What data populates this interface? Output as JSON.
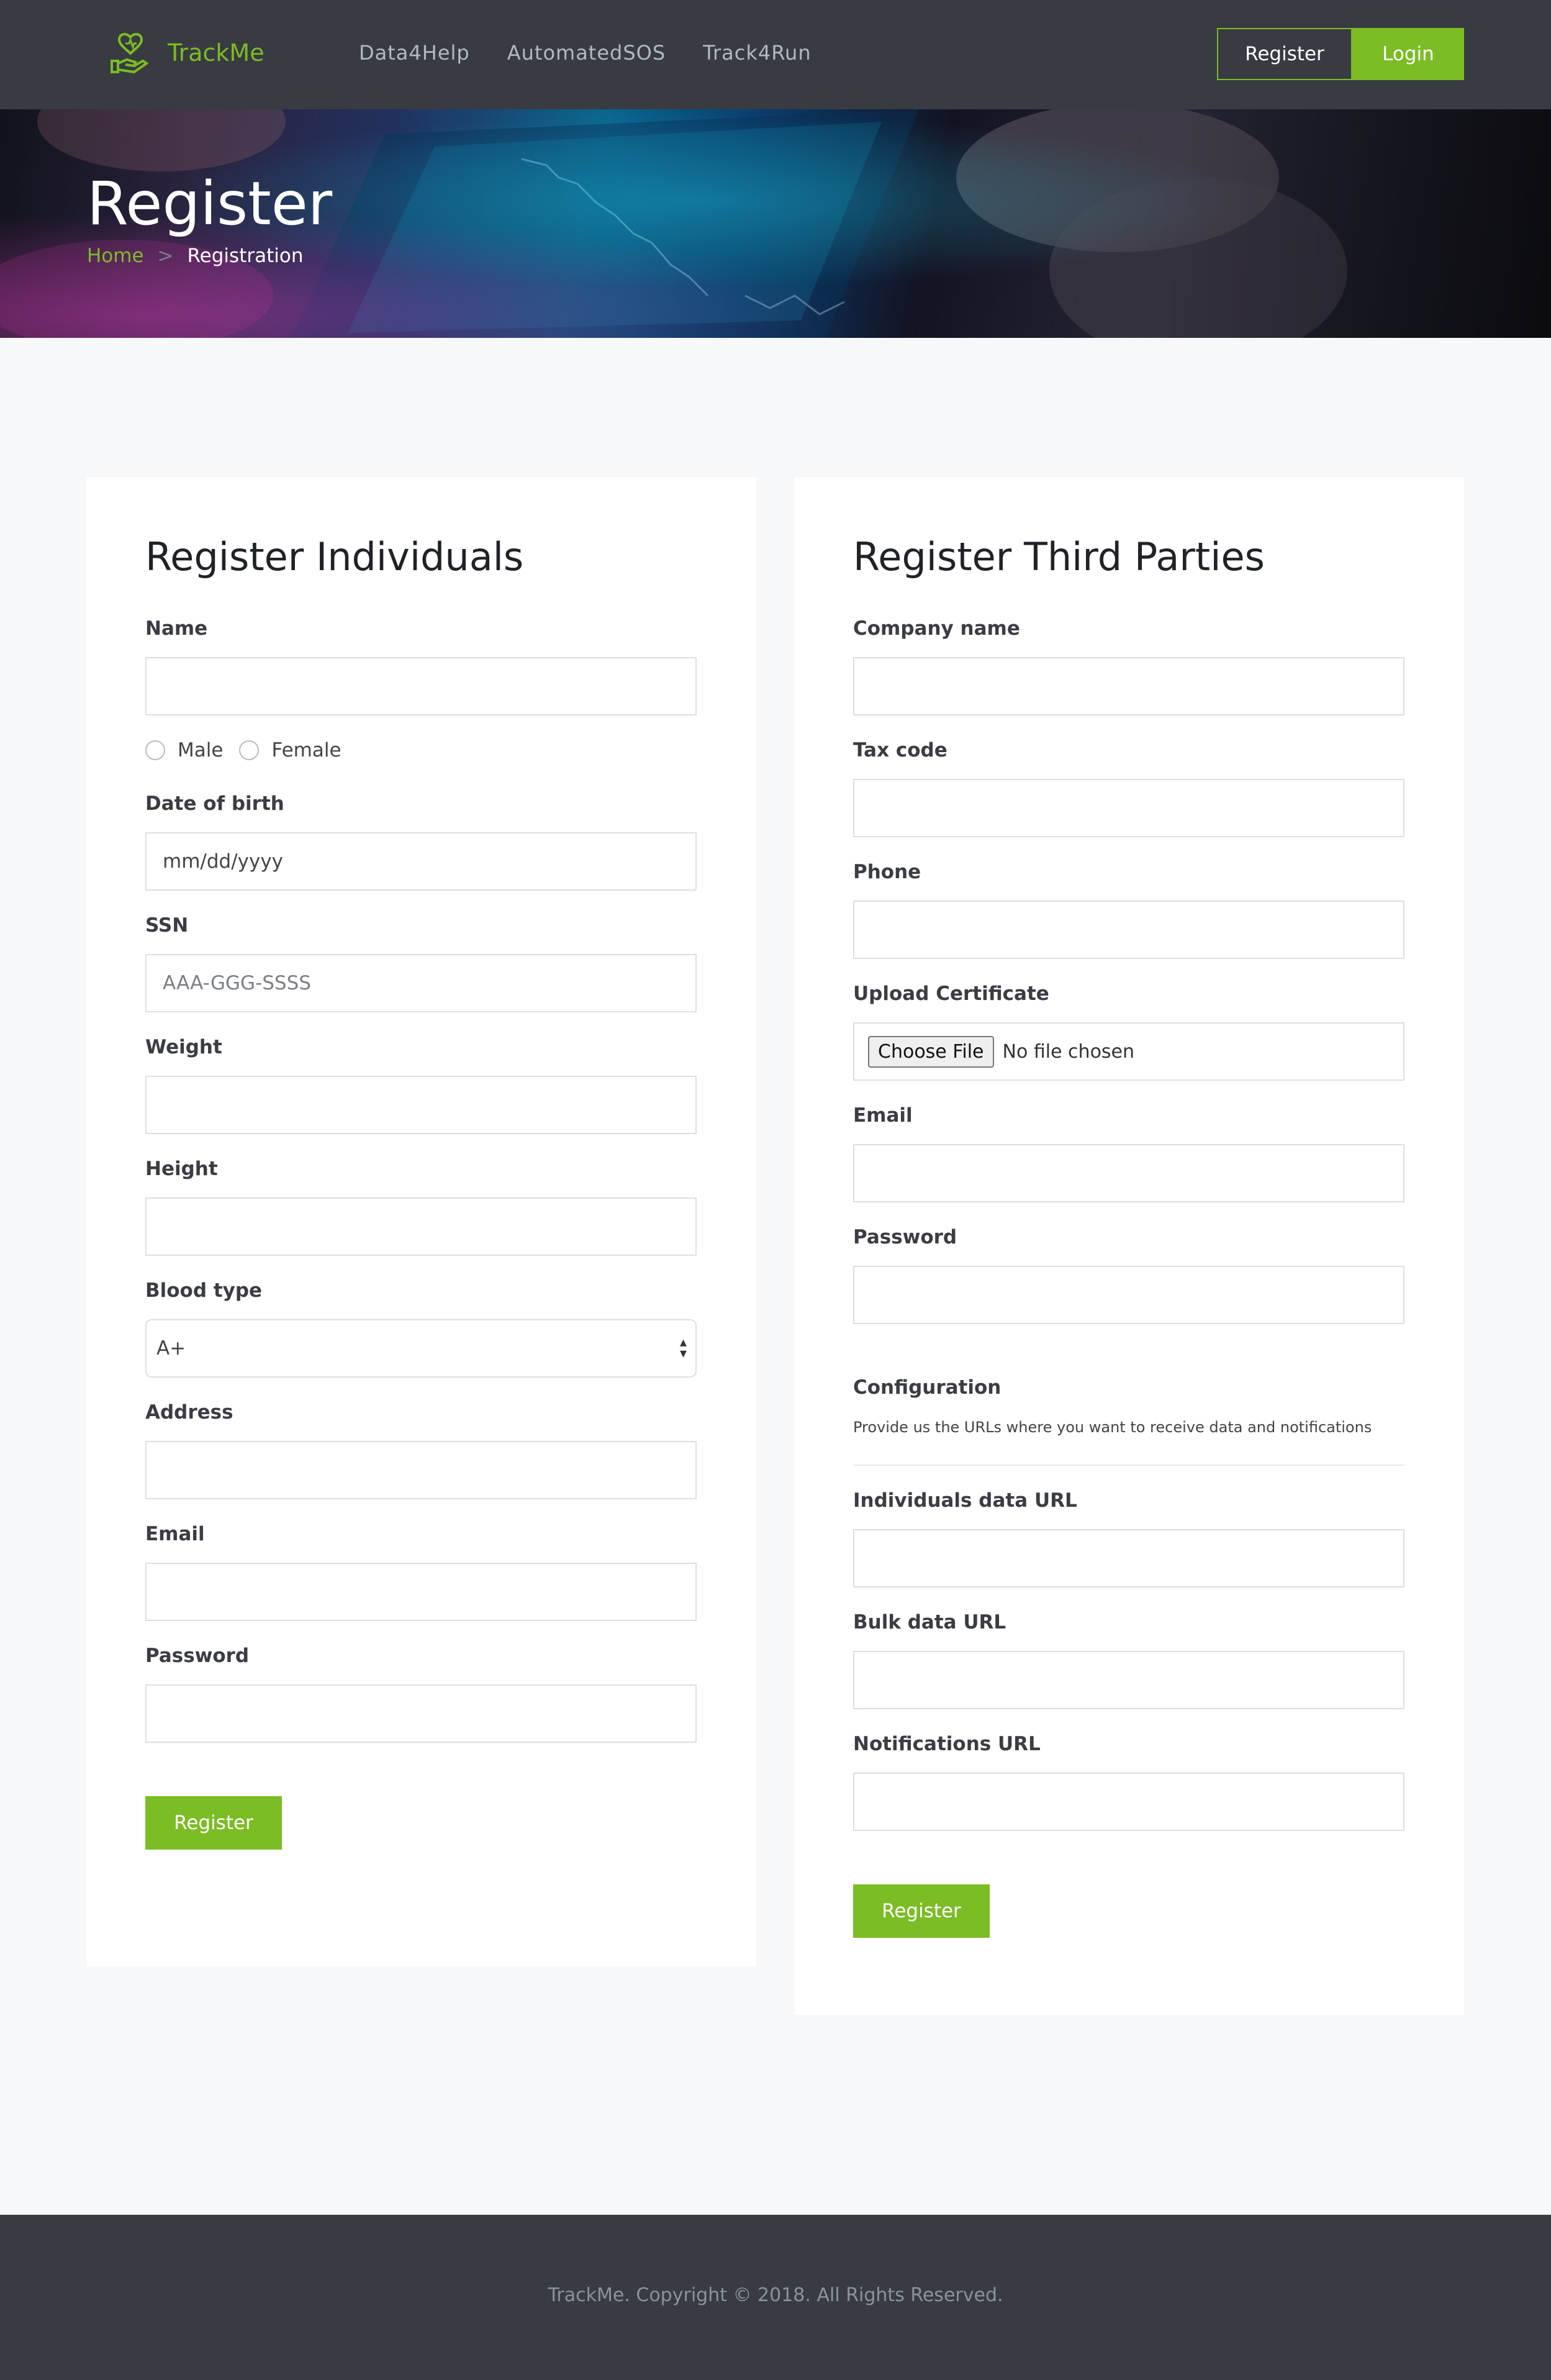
{
  "header": {
    "brand": "TrackMe",
    "nav": [
      "Data4Help",
      "AutomatedSOS",
      "Track4Run"
    ],
    "register_label": "Register",
    "login_label": "Login"
  },
  "hero": {
    "title": "Register",
    "breadcrumb_home": "Home",
    "breadcrumb_sep": ">",
    "breadcrumb_current": "Registration"
  },
  "individuals": {
    "title": "Register Individuals",
    "name_label": "Name",
    "gender_options": [
      "Male",
      "Female"
    ],
    "dob_label": "Date of birth",
    "dob_placeholder": "mm/dd/yyyy",
    "ssn_label": "SSN",
    "ssn_placeholder": "AAA-GGG-SSSS",
    "weight_label": "Weight",
    "height_label": "Height",
    "blood_label": "Blood type",
    "blood_value": "A+",
    "address_label": "Address",
    "email_label": "Email",
    "password_label": "Password",
    "submit_label": "Register"
  },
  "third_parties": {
    "title": "Register Third Parties",
    "company_label": "Company name",
    "tax_label": "Tax code",
    "phone_label": "Phone",
    "upload_label": "Upload Certificate",
    "file_button": "Choose File",
    "file_status": "No file chosen",
    "email_label": "Email",
    "password_label": "Password",
    "config_label": "Configuration",
    "config_desc": "Provide us the URLs where you want to receive data and notifications",
    "individuals_url_label": "Individuals data URL",
    "bulk_url_label": "Bulk data URL",
    "notifications_url_label": "Notifications URL",
    "submit_label": "Register"
  },
  "footer": {
    "text": "TrackMe. Copyright © 2018. All Rights Reserved."
  },
  "colors": {
    "accent": "#7cbc24",
    "header_bg": "#383b41"
  }
}
